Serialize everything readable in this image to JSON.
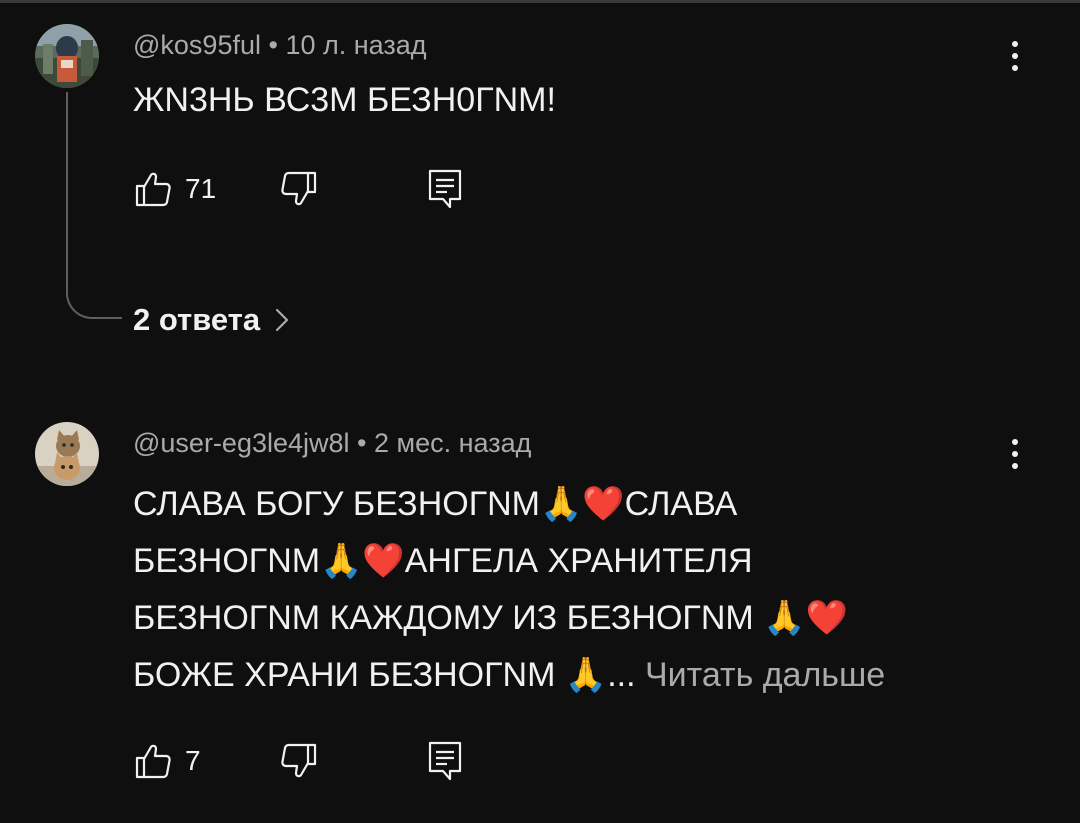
{
  "colors": {
    "background": "#0f0f0f",
    "primary_text": "#f1f1f1",
    "secondary_text": "#aaaaaa",
    "thread_line": "#5f5f5f"
  },
  "comments": [
    {
      "author": "@kos95ful",
      "separator": "•",
      "time": "10 л. назад",
      "text": "ЖN3НЬ ВС3М БЕЗН0ГNМ!",
      "likes": "71",
      "avatar_icon": "user-avatar-photo",
      "replies_label": "2 ответа"
    },
    {
      "author": "@user-eg3le4jw8l",
      "separator": "•",
      "time": "2 мес. назад",
      "text_lines": [
        "СЛАВА БОГУ БЕЗНОГNМ🙏❤️СЛАВА",
        "БЕЗНОГNМ🙏❤️АНГЕЛА ХРАНИТЕЛЯ",
        "БЕЗНОГNМ КАЖДОМУ ИЗ БЕЗНОГNМ 🙏❤️",
        "БОЖЕ ХРАНИ БЕЗНОГNМ 🙏..."
      ],
      "read_more": "Читать дальше",
      "likes": "7",
      "avatar_icon": "cat-avatar-photo"
    }
  ]
}
